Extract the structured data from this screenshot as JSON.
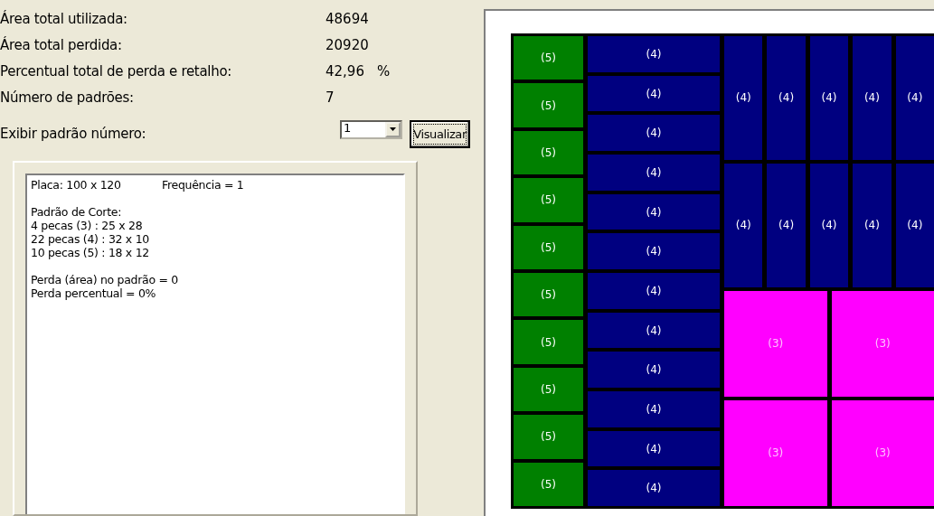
{
  "summary": [
    {
      "label": "Área total utilizada:",
      "value": "48694"
    },
    {
      "label": "Área total perdida:",
      "value": "20920"
    },
    {
      "label": "Percentual total de perda e retalho:",
      "value": "42,96",
      "unit": "%"
    },
    {
      "label": "Número de padrões:",
      "value": "7"
    }
  ],
  "pattern_select": {
    "label": "Exibir padrão número:",
    "value": "1",
    "button": "Visualizar"
  },
  "memo": {
    "plate": "Placa: 100 x 120",
    "frequency": "Frequência = 1",
    "blocks": [
      [
        "Padrão de Corte:",
        "4 pecas (3) : 25 x 28",
        "22 pecas (4) : 32 x 10",
        "10 pecas (5) : 18 x 12"
      ],
      [
        "Perda (área) no padrão = 0",
        "Perda percentual = 0%"
      ]
    ]
  },
  "board": {
    "sections": [
      {
        "kind": "column",
        "pieces": [
          {
            "label": "(5)",
            "color": "#008000"
          },
          {
            "label": "(5)",
            "color": "#008000"
          },
          {
            "label": "(5)",
            "color": "#008000"
          },
          {
            "label": "(5)",
            "color": "#008000"
          },
          {
            "label": "(5)",
            "color": "#008000"
          },
          {
            "label": "(5)",
            "color": "#008000"
          },
          {
            "label": "(5)",
            "color": "#008000"
          },
          {
            "label": "(5)",
            "color": "#008000"
          },
          {
            "label": "(5)",
            "color": "#008000"
          },
          {
            "label": "(5)",
            "color": "#008000"
          }
        ]
      },
      {
        "kind": "column",
        "pieces": [
          {
            "label": "(4)",
            "color": "#000080"
          },
          {
            "label": "(4)",
            "color": "#000080"
          },
          {
            "label": "(4)",
            "color": "#000080"
          },
          {
            "label": "(4)",
            "color": "#000080"
          },
          {
            "label": "(4)",
            "color": "#000080"
          },
          {
            "label": "(4)",
            "color": "#000080"
          },
          {
            "label": "(4)",
            "color": "#000080"
          },
          {
            "label": "(4)",
            "color": "#000080"
          },
          {
            "label": "(4)",
            "color": "#000080"
          },
          {
            "label": "(4)",
            "color": "#000080"
          },
          {
            "label": "(4)",
            "color": "#000080"
          },
          {
            "label": "(4)",
            "color": "#000080"
          }
        ]
      },
      {
        "kind": "stack",
        "grids": [
          {
            "rows": [
              [
                {
                  "label": "(4)",
                  "color": "#000080"
                },
                {
                  "label": "(4)",
                  "color": "#000080"
                },
                {
                  "label": "(4)",
                  "color": "#000080"
                },
                {
                  "label": "(4)",
                  "color": "#000080"
                },
                {
                  "label": "(4)",
                  "color": "#000080"
                }
              ],
              [
                {
                  "label": "(4)",
                  "color": "#000080"
                },
                {
                  "label": "(4)",
                  "color": "#000080"
                },
                {
                  "label": "(4)",
                  "color": "#000080"
                },
                {
                  "label": "(4)",
                  "color": "#000080"
                },
                {
                  "label": "(4)",
                  "color": "#000080"
                }
              ]
            ]
          },
          {
            "rows": [
              [
                {
                  "label": "(3)",
                  "color": "#ff00ff"
                },
                {
                  "label": "(3)",
                  "color": "#ff00ff"
                }
              ],
              [
                {
                  "label": "(3)",
                  "color": "#ff00ff"
                },
                {
                  "label": "(3)",
                  "color": "#ff00ff"
                }
              ]
            ]
          }
        ]
      }
    ]
  }
}
